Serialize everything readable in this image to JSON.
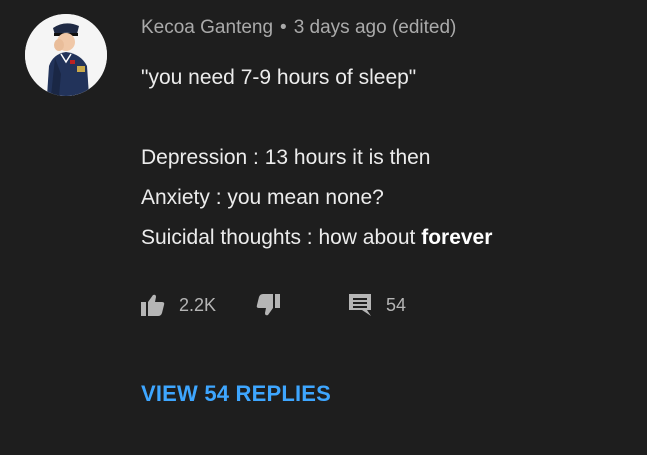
{
  "comment": {
    "author": "Kecoa Ganteng",
    "separator": "•",
    "time": "3 days ago (edited)",
    "lines": {
      "quote": "\"you need 7-9 hours of sleep\"",
      "depression": "Depression : 13 hours it is then",
      "anxiety": "Anxiety : you mean none?",
      "suicidal_prefix": "Suicidal thoughts : how about ",
      "suicidal_bold": "forever"
    }
  },
  "actions": {
    "like_count": "2.2K",
    "reply_count": "54",
    "icons": [
      "thumbs-up-icon",
      "thumbs-down-icon",
      "comment-icon"
    ]
  },
  "view_replies_label": "VIEW 54 REPLIES",
  "colors": {
    "background": "#1e1e1e",
    "text": "#ececec",
    "meta": "#aaaaaa",
    "link": "#3ea6ff"
  }
}
